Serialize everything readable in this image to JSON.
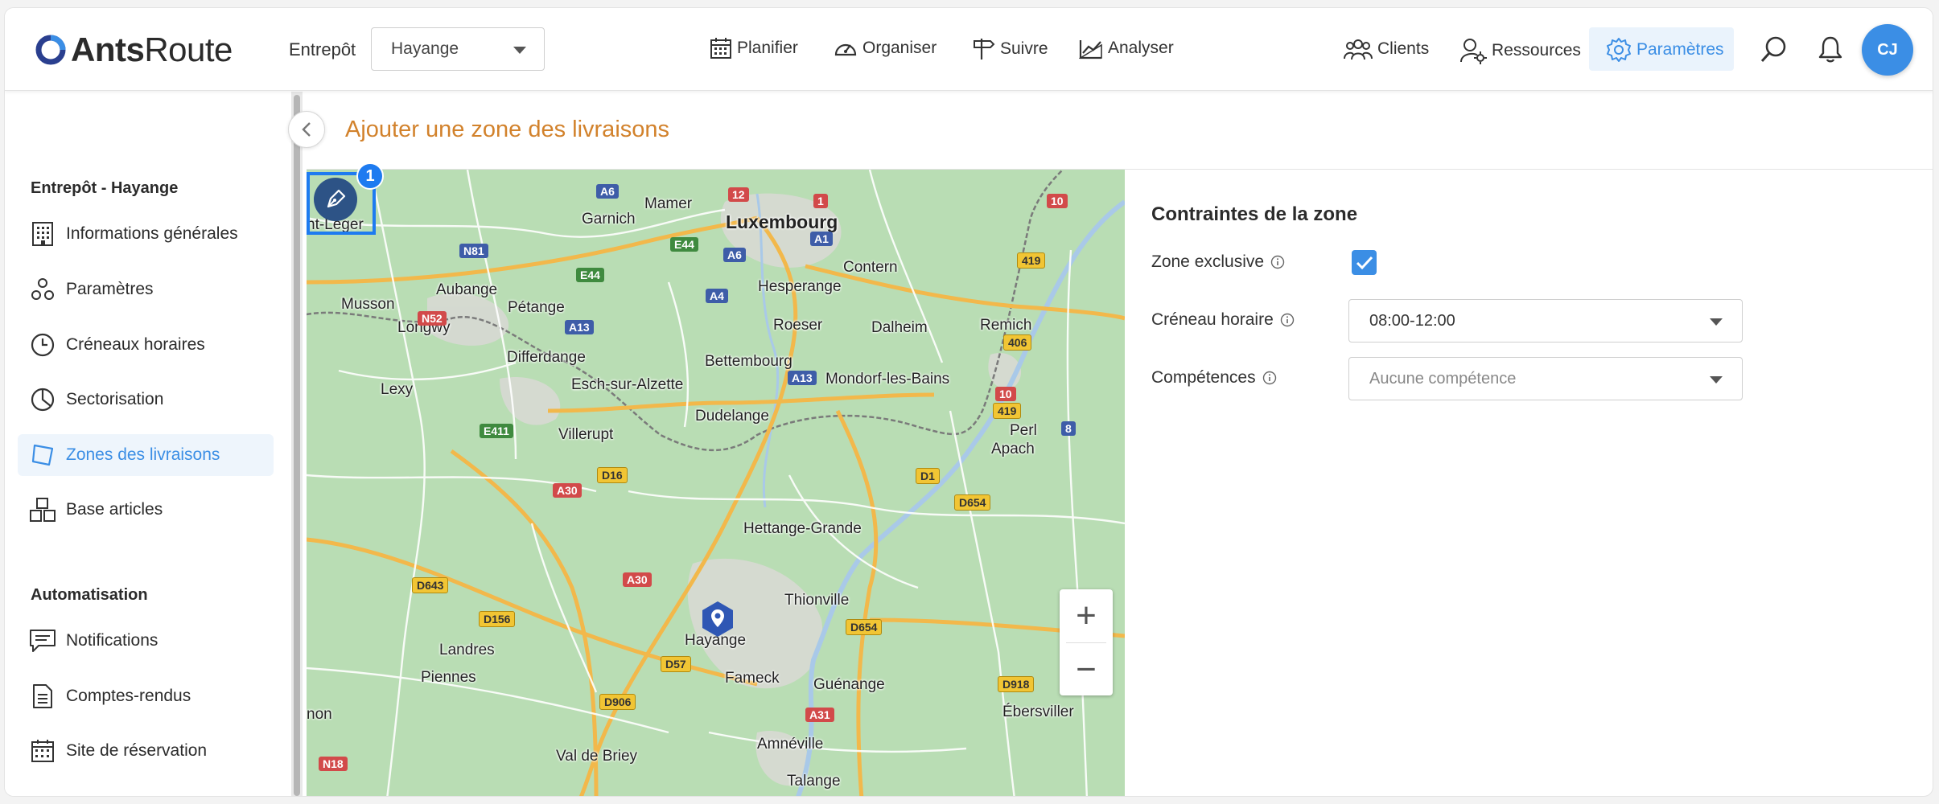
{
  "app": {
    "logo_bold": "Ants",
    "logo_regular": "Route"
  },
  "header": {
    "entrepot_label": "Entrepôt",
    "entrepot_value": "Hayange",
    "nav": {
      "planifier": "Planifier",
      "organiser": "Organiser",
      "suivre": "Suivre",
      "analyser": "Analyser"
    },
    "right_nav": {
      "clients": "Clients",
      "ressources": "Ressources",
      "parametres": "Paramètres"
    },
    "avatar_initials": "CJ"
  },
  "sidebar": {
    "section1_title": "Entrepôt - Hayange",
    "items": [
      {
        "label": "Informations générales",
        "icon": "building-icon"
      },
      {
        "label": "Paramètres",
        "icon": "shapes-icon"
      },
      {
        "label": "Créneaux horaires",
        "icon": "clock-icon"
      },
      {
        "label": "Sectorisation",
        "icon": "pie-chart-icon"
      },
      {
        "label": "Zones des livraisons",
        "icon": "polygon-icon",
        "active": true
      },
      {
        "label": "Base articles",
        "icon": "boxes-icon"
      }
    ],
    "section2_title": "Automatisation",
    "items2": [
      {
        "label": "Notifications",
        "icon": "message-icon"
      },
      {
        "label": "Comptes-rendus",
        "icon": "document-icon"
      },
      {
        "label": "Site de réservation",
        "icon": "calendar-icon"
      }
    ]
  },
  "page": {
    "title": "Ajouter une zone des livraisons"
  },
  "map": {
    "draw_badge": "1",
    "zoom_in": "+",
    "zoom_out": "−",
    "labels": {
      "luxembourg": "Luxembourg",
      "mamer": "Mamer",
      "garnich": "Garnich",
      "contern": "Contern",
      "hesperange": "Hesperange",
      "musson": "Musson",
      "aubange": "Aubange",
      "petange": "Pétange",
      "longwy": "Longwy",
      "differdange": "Differdange",
      "roeser": "Roeser",
      "dalheim": "Dalheim",
      "remich": "Remich",
      "bettembourg": "Bettembourg",
      "esch": "Esch-sur-Alzette",
      "mondorf": "Mondorf-les-Bains",
      "lexy": "Lexy",
      "dudelange": "Dudelange",
      "villerupt": "Villerupt",
      "perl": "Perl",
      "apach": "Apach",
      "hettange": "Hettange-Grande",
      "thionville": "Thionville",
      "hayange": "Hayange",
      "landres": "Landres",
      "piennes": "Piennes",
      "fameck": "Fameck",
      "guenange": "Guénange",
      "ebersviller": "Ébersviller",
      "non": "non",
      "valdebriey": "Val de Briey",
      "amneville": "Amnéville",
      "talange": "Talange",
      "saintleger": "nt-Léger"
    },
    "shields": {
      "a6a": "A6",
      "n12": "12",
      "n1": "1",
      "n10a": "10",
      "n81": "N81",
      "e44a": "E44",
      "e44b": "E44",
      "a6b": "A6",
      "a1": "A1",
      "n419a": "419",
      "a4": "A4",
      "n52": "N52",
      "a13a": "A13",
      "n406": "406",
      "a13b": "A13",
      "n10b": "10",
      "n419b": "419",
      "e411": "E411",
      "n8": "8",
      "d16": "D16",
      "a30a": "A30",
      "d1": "D1",
      "d654a": "D654",
      "a30b": "A30",
      "d643": "D643",
      "d156": "D156",
      "d654b": "D654",
      "d57": "D57",
      "d918": "D918",
      "d906": "D906",
      "a31": "A31",
      "n18": "N18"
    }
  },
  "constraints": {
    "title": "Contraintes de la zone",
    "exclusive_label": "Zone exclusive",
    "exclusive_checked": true,
    "creneau_label": "Créneau horaire",
    "creneau_value": "08:00-12:00",
    "competences_label": "Compétences",
    "competences_placeholder": "Aucune compétence"
  },
  "colors": {
    "accent": "#3b8ee5",
    "title_orange": "#d2822c",
    "map_green": "#b9ddb4"
  }
}
